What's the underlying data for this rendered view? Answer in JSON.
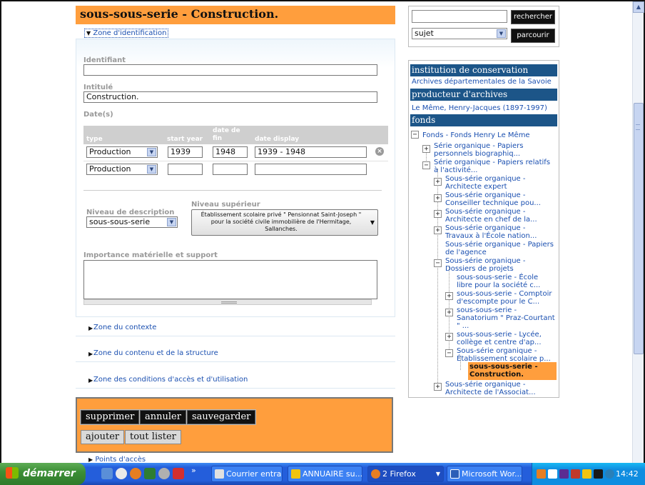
{
  "record": {
    "title": "sous-sous-serie - Construction.",
    "zone_identification": "Zone d'identification",
    "labels": {
      "identifiant": "Identifiant",
      "intitule": "Intitulé",
      "dates": "Date(s)",
      "type": "type",
      "start_year": "start year",
      "date_de_fin": "date de fin",
      "date_display": "date display",
      "niveau_description": "Niveau de description",
      "niveau_superieur": "Niveau supérieur",
      "importance": "Importance matérielle et support"
    },
    "fields": {
      "identifiant": "",
      "intitule": "Construction."
    },
    "date_rows": [
      {
        "type": "Production",
        "start": "1939",
        "end": "1948",
        "display": "1939 - 1948"
      },
      {
        "type": "Production",
        "start": "",
        "end": "",
        "display": ""
      }
    ],
    "niveau_description": "sous-sous-serie",
    "niveau_superieur": "Établissement scolaire privé \" Pensionnat Saint-Joseph \" pour la société civile immobilière de l'Hermitage, Sallanches.",
    "zones": [
      "Zone du contexte",
      "Zone du contenu et de la structure",
      "Zone des conditions d'accès et d'utilisation"
    ],
    "actions": {
      "supprimer": "supprimer",
      "annuler": "annuler",
      "sauvegarder": "sauvegarder",
      "ajouter": "ajouter",
      "tout_lister": "tout lister"
    },
    "points_acces": "Points d'accès"
  },
  "search": {
    "rechercher": "rechercher",
    "subject": "sujet",
    "parcourir": "parcourir"
  },
  "sidebar": {
    "institution_head": "institution de conservation",
    "institution": "Archives départementales de la Savoie",
    "producteur_head": "producteur d'archives",
    "producteur": "Le Même, Henry-Jacques (1897-1997)",
    "fonds_head": "fonds",
    "tree": {
      "root": "Fonds - Fonds Henry Le Même",
      "items": [
        {
          "l1": "Série organique - Papiers",
          "l2": "personnels biographiq..."
        },
        {
          "l1": "Série organique - Papiers relatifs",
          "l2": "à l'activité..."
        },
        {
          "l1": "Sous-série organique -",
          "l2": "Architecte expert"
        },
        {
          "l1": "Sous-série organique -",
          "l2": "Conseiller technique pou..."
        },
        {
          "l1": "Sous-série organique -",
          "l2": "Architecte en chef de la..."
        },
        {
          "l1": "Sous-série organique -",
          "l2": "Travaux à l'École nation..."
        },
        {
          "l1": "Sous-série organique - Papiers",
          "l2": "de l'agence"
        },
        {
          "l1": "Sous-série organique -",
          "l2": "Dossiers de projets"
        },
        {
          "l1": "sous-sous-serie - École",
          "l2": "libre pour la société c..."
        },
        {
          "l1": "sous-sous-serie - Comptoir",
          "l2": "d'escompte pour le C..."
        },
        {
          "l1": "sous-sous-serie -",
          "l2": "Sanatorium \" Praz-Courtant",
          "l3": "\" ..."
        },
        {
          "l1": "sous-sous-serie - Lycée,",
          "l2": "collège et centre d'ap..."
        },
        {
          "l1": "Sous-série organique -",
          "l2": "Établissement scolaire p..."
        },
        {
          "l1": "Sous-série organique -",
          "l2": "Architecte de l'Associat..."
        }
      ],
      "current": {
        "l1": "sous-sous-serie -",
        "l2": "Construction."
      }
    }
  },
  "taskbar": {
    "start": "démarrer",
    "more": "»",
    "buttons": [
      "Courrier entra...",
      "ANNUAIRE su...",
      "2 Firefox",
      "Microsoft Wor..."
    ],
    "clock": "14:42"
  }
}
